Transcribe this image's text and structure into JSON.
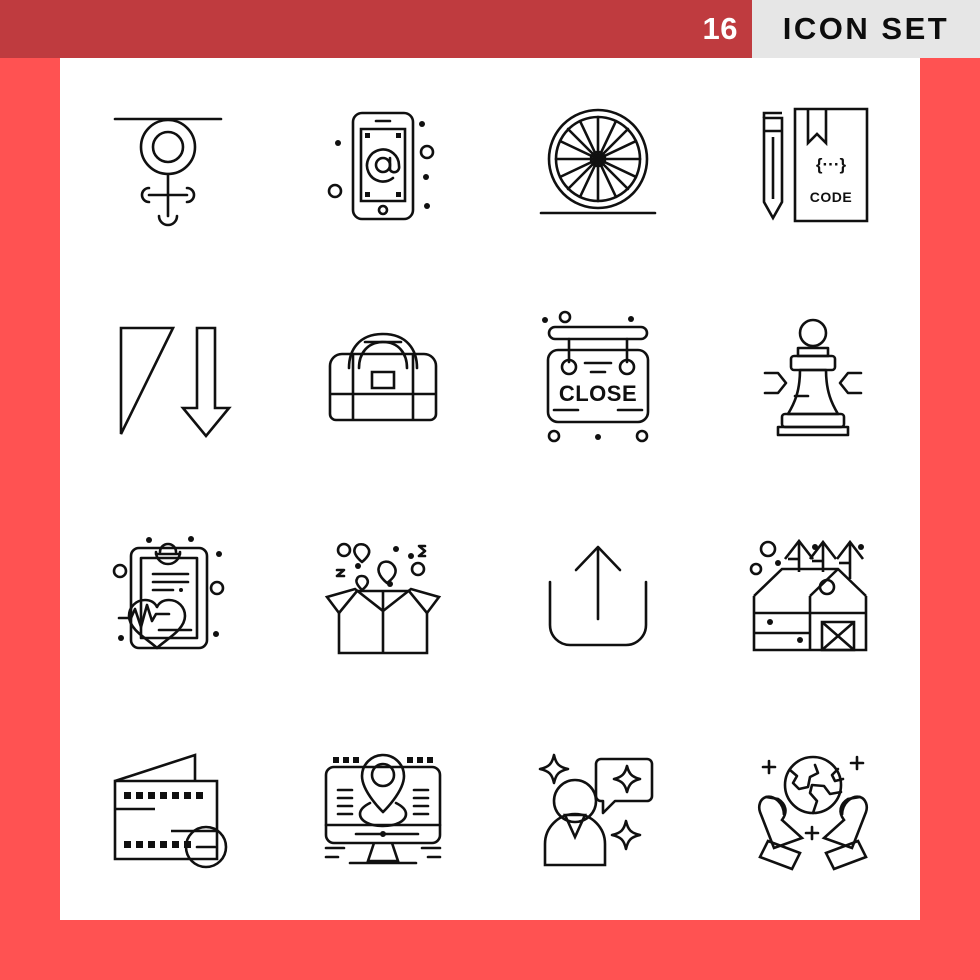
{
  "header": {
    "count": "16",
    "title": "ICON SET",
    "badge_color": "#bf3b3f",
    "plate_color": "#e6e6e6",
    "frame_color": "#ff5252",
    "stroke_color": "#101010"
  },
  "icons": [
    {
      "name": "female-gender-symbol-icon",
      "label": "Female gender symbol hanging from line"
    },
    {
      "name": "mobile-email-icon",
      "label": "Smartphone with at sign"
    },
    {
      "name": "wagon-wheel-icon",
      "label": "Spoked wagon wheel on ground line"
    },
    {
      "name": "coding-book-icon",
      "label": "Code book with pencil and bookmark",
      "book_text": "CODE",
      "brace_text": "{···}"
    },
    {
      "name": "flag-down-arrow-icon",
      "label": "Triangular flag with downward arrow"
    },
    {
      "name": "duffel-bag-icon",
      "label": "Sports duffel bag with handles"
    },
    {
      "name": "close-signboard-icon",
      "label": "Hanging CLOSE sign board",
      "sign_text": "CLOSE"
    },
    {
      "name": "chess-pawn-icon",
      "label": "Chess pawn with focus marks"
    },
    {
      "name": "medical-report-icon",
      "label": "Clipboard with heart and pulse line"
    },
    {
      "name": "gift-box-hearts-icon",
      "label": "Open box with hearts floating out"
    },
    {
      "name": "upload-share-icon",
      "label": "Up arrow out of container"
    },
    {
      "name": "farm-barn-icon",
      "label": "Barn with trees"
    },
    {
      "name": "wallet-remove-icon",
      "label": "Wallet with minus circle"
    },
    {
      "name": "desktop-location-icon",
      "label": "Monitor with map location pin"
    },
    {
      "name": "user-testimonial-icon",
      "label": "Person with speech bubble and sparkles"
    },
    {
      "name": "hands-globe-icon",
      "label": "Hands holding the globe"
    }
  ]
}
